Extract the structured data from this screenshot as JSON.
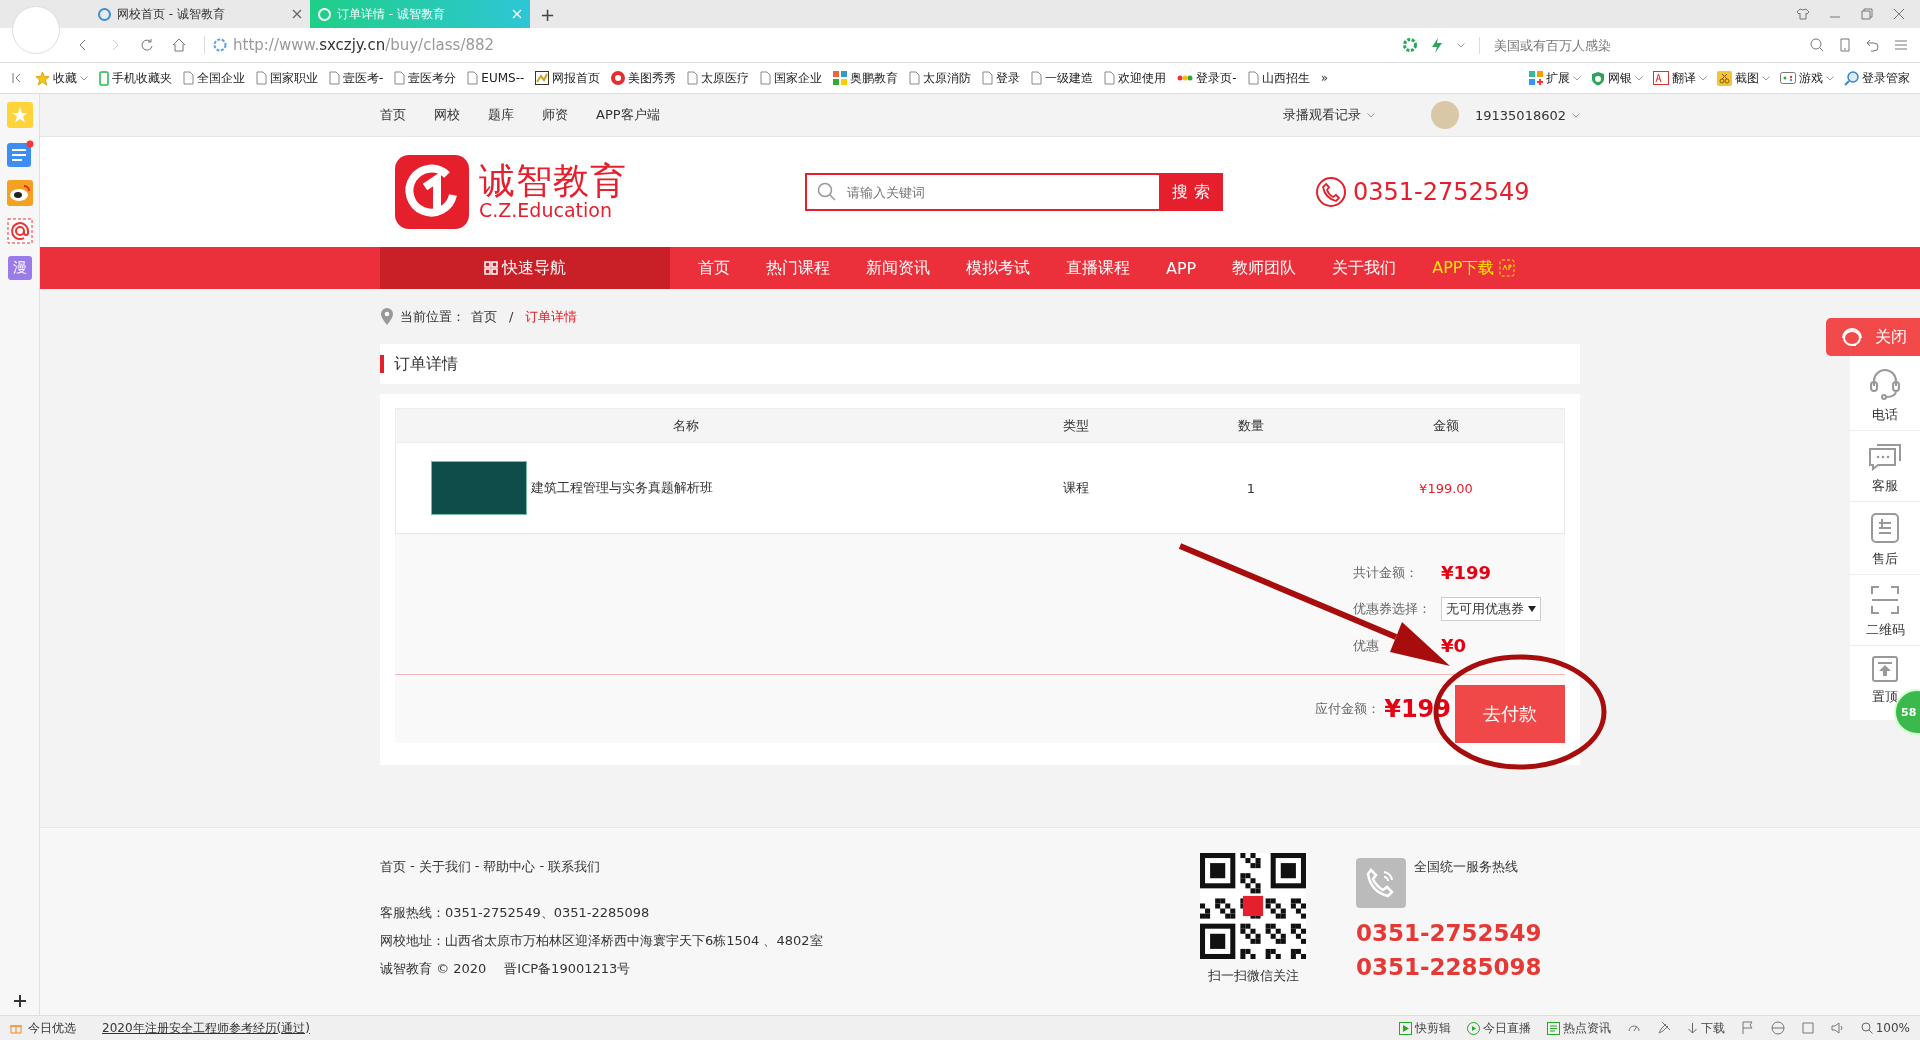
{
  "browser": {
    "tabs": [
      {
        "title": "网校首页 - 诚智教育",
        "selected": false
      },
      {
        "title": "订单详情 - 诚智教育",
        "selected": true
      }
    ],
    "new_tab": "+",
    "url": {
      "prefix": "http://www.",
      "domain": "sxczjy.cn",
      "path": "/buy/class/882"
    },
    "search_placeholder": "美国或有百万人感染",
    "bookmarks": [
      {
        "label": "收藏",
        "kind": "star",
        "dropdown": true
      },
      {
        "label": "手机收藏夹",
        "kind": "phone",
        "dropdown": false
      },
      {
        "label": "全国企业",
        "kind": "page",
        "dropdown": false
      },
      {
        "label": "国家职业",
        "kind": "page",
        "dropdown": false
      },
      {
        "label": "壹医考-",
        "kind": "page",
        "dropdown": false
      },
      {
        "label": "壹医考分",
        "kind": "page",
        "dropdown": false
      },
      {
        "label": "EUMS--",
        "kind": "page",
        "dropdown": false
      },
      {
        "label": "网报首页",
        "kind": "picture",
        "dropdown": false
      },
      {
        "label": "美图秀秀",
        "kind": "badge",
        "dropdown": false
      },
      {
        "label": "太原医疗",
        "kind": "page",
        "dropdown": false
      },
      {
        "label": "国家企业",
        "kind": "page",
        "dropdown": false
      },
      {
        "label": "奥鹏教育",
        "kind": "grid",
        "dropdown": false
      },
      {
        "label": "太原消防",
        "kind": "page",
        "dropdown": false
      },
      {
        "label": "登录",
        "kind": "page",
        "dropdown": false
      },
      {
        "label": "一级建造",
        "kind": "page",
        "dropdown": false
      },
      {
        "label": "欢迎使用",
        "kind": "page",
        "dropdown": false
      },
      {
        "label": "登录页-",
        "kind": "dots",
        "dropdown": false
      },
      {
        "label": "山西招生",
        "kind": "page",
        "dropdown": false
      }
    ],
    "bookmarks_more": "»",
    "tools": [
      {
        "label": "扩展",
        "kind": "extension",
        "dropdown": true
      },
      {
        "label": "网银",
        "kind": "bank",
        "dropdown": true
      },
      {
        "label": "翻译",
        "kind": "translate",
        "dropdown": true
      },
      {
        "label": "截图",
        "kind": "screenshot",
        "dropdown": true
      },
      {
        "label": "游戏",
        "kind": "game",
        "dropdown": true
      },
      {
        "label": "登录管家",
        "kind": "login",
        "dropdown": false
      }
    ]
  },
  "left_sidebar": [
    {
      "kind": "star"
    },
    {
      "kind": "list"
    },
    {
      "kind": "weibo"
    },
    {
      "kind": "mail"
    },
    {
      "kind": "text",
      "label": "漫"
    }
  ],
  "site": {
    "top_links": [
      "首页",
      "网校",
      "题库",
      "师资",
      "APP客户端"
    ],
    "history": "录播观看记录",
    "user": "19135018602",
    "logo_title": "诚智教育",
    "logo_subtitle": "C.Z.Education",
    "search": {
      "placeholder": "请输入关键词",
      "button": "搜 索"
    },
    "hotline": "0351-2752549",
    "quick_nav": "快速导航",
    "nav": [
      {
        "label": "首页",
        "highlight": false
      },
      {
        "label": "热门课程",
        "highlight": false
      },
      {
        "label": "新闻资讯",
        "highlight": false
      },
      {
        "label": "模拟考试",
        "highlight": false
      },
      {
        "label": "直播课程",
        "highlight": false
      },
      {
        "label": "APP",
        "highlight": false
      },
      {
        "label": "教师团队",
        "highlight": false
      },
      {
        "label": "关于我们",
        "highlight": false
      },
      {
        "label": "APP下载",
        "highlight": true
      }
    ]
  },
  "breadcrumb": {
    "label": "当前位置：",
    "separator": "/",
    "items": [
      {
        "label": "首页",
        "current": false
      },
      {
        "label": "订单详情",
        "current": true
      }
    ]
  },
  "order": {
    "title": "订单详情",
    "columns": [
      "名称",
      "类型",
      "数量",
      "金额"
    ],
    "rows": [
      {
        "name": "建筑工程管理与实务真题解析班",
        "type": "课程",
        "quantity": "1",
        "amount": "¥199.00"
      }
    ],
    "total_label": "共计金额：",
    "total": "¥199",
    "coupon_label": "优惠券选择：",
    "coupon_value": "无可用优惠券",
    "discount_label": "优惠",
    "discount": "¥0",
    "payable_label": "应付金额：",
    "payable": "¥199",
    "pay_button": "去付款"
  },
  "footer": {
    "links": [
      "首页",
      "关于我们",
      "帮助中心",
      "联系我们"
    ],
    "separator": "-",
    "lines": [
      "客服热线：0351-2752549、0351-2285098",
      "网校地址：山西省太原市万柏林区迎泽桥西中海寰宇天下6栋1504 、4802室"
    ],
    "copyright": "诚智教育 © 2020",
    "icp": "晋ICP备19001213号",
    "qr_caption": "扫一扫微信关注",
    "hotline_title": "全国统一服务热线",
    "hotlines": [
      "0351-2752549",
      "0351-2285098"
    ]
  },
  "float_panel": {
    "close": "关闭",
    "items": [
      {
        "label": "电话",
        "kind": "phone"
      },
      {
        "label": "客服",
        "kind": "chat"
      },
      {
        "label": "售后",
        "kind": "service"
      },
      {
        "label": "二维码",
        "kind": "qr"
      },
      {
        "label": "置顶",
        "kind": "top"
      }
    ],
    "badge": "58"
  },
  "status_bar": {
    "left": "今日优选",
    "news": "2020年注册安全工程师参考经历(通过)",
    "right": [
      {
        "label": "快剪辑",
        "kind": "clip"
      },
      {
        "label": "今日直播",
        "kind": "live"
      },
      {
        "label": "热点资讯",
        "kind": "news"
      },
      {
        "label": "下载",
        "kind": "download"
      },
      {
        "label": "100%",
        "kind": "zoom"
      }
    ]
  }
}
